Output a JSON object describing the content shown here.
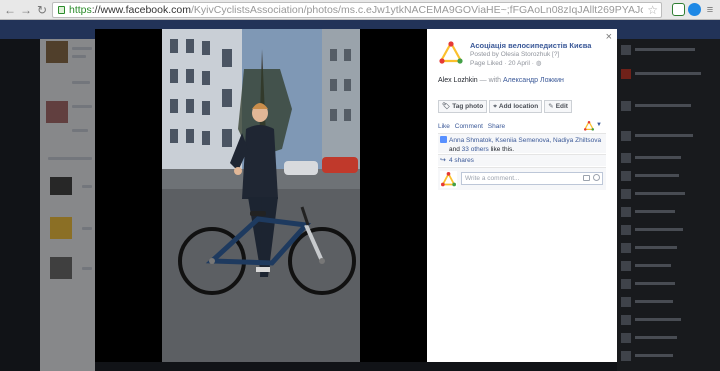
{
  "browser": {
    "url_https": "https",
    "url_host": "://www.facebook.com",
    "url_path": "/KyivCyclistsAssociation/photos/ms.c.eJw1ytkNACEMA9GOViaHE~;fFGAoLn08zIqJAllt269PYAJcszH4vTzC1Mq5b8xf5~;.jqOvl2YH9i"
  },
  "viewer": {
    "close_label": "×",
    "page_name": "Асоціація велосипедистів Києва",
    "posted_by": "Posted by Olesia Storozhuk [?]",
    "page_liked": "Page Liked · 20 April · ",
    "caption_name": "Alex Lozhkin",
    "caption_with": "— with",
    "caption_tag": "Александр Ложкин",
    "buttons": {
      "tag_photo": "Tag photo",
      "add_location": "Add location",
      "edit": "Edit"
    },
    "actions": {
      "like": "Like",
      "comment": "Comment",
      "share": "Share"
    },
    "likes": {
      "names": "Anna Shmatok, Kseniia Semenova, Nadiya Zhiltsova",
      "and": "and",
      "others": "33 others",
      "tail": "like this."
    },
    "shares": "4 shares",
    "comment_placeholder": "Write a comment..."
  },
  "colors": {
    "fb_blue": "#3b5998",
    "logo_red": "#e53935",
    "logo_green": "#43a047",
    "logo_yellow": "#fbc02d"
  }
}
